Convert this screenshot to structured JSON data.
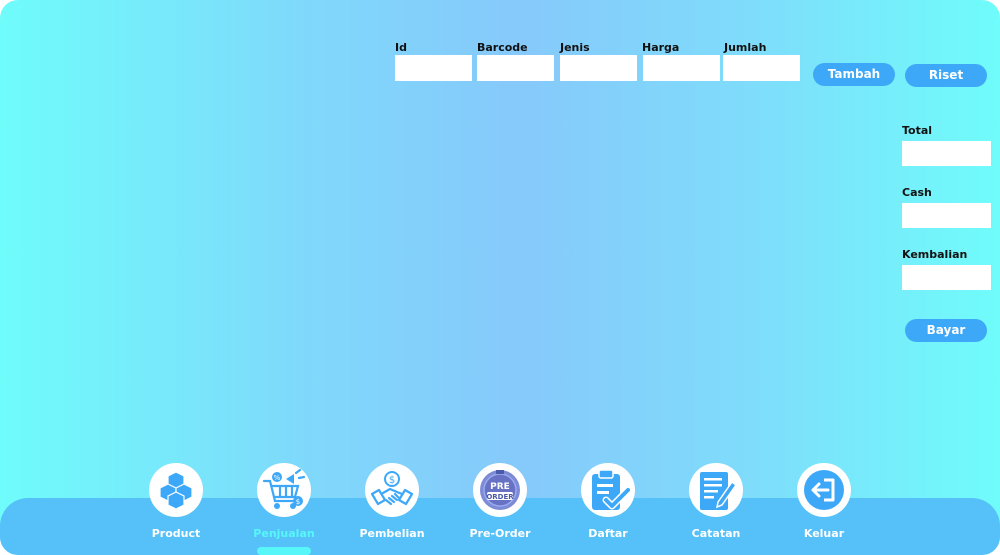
{
  "form": {
    "fields": [
      {
        "label": "Id",
        "value": ""
      },
      {
        "label": "Barcode",
        "value": ""
      },
      {
        "label": "Jenis",
        "value": ""
      },
      {
        "label": "Harga",
        "value": ""
      },
      {
        "label": "Jumlah",
        "value": ""
      }
    ],
    "tambah_label": "Tambah",
    "riset_label": "Riset"
  },
  "summary": {
    "total_label": "Total",
    "total_value": "",
    "cash_label": "Cash",
    "cash_value": "",
    "kembalian_label": "Kembalian",
    "kembalian_value": "",
    "bayar_label": "Bayar"
  },
  "nav": {
    "items": [
      {
        "label": "Product",
        "icon": "boxes-icon"
      },
      {
        "label": "Penjualan",
        "icon": "shopping-cart-icon"
      },
      {
        "label": "Pembelian",
        "icon": "handshake-icon"
      },
      {
        "label": "Pre-Order",
        "icon": "pre-order-badge-icon"
      },
      {
        "label": "Daftar",
        "icon": "clipboard-check-icon"
      },
      {
        "label": "Catatan",
        "icon": "notepad-pen-icon"
      },
      {
        "label": "Keluar",
        "icon": "exit-icon"
      }
    ],
    "active_index": 1
  },
  "colors": {
    "accent": "#3ea8f8",
    "dock": "#56c1f9",
    "active": "#57f7f9"
  }
}
